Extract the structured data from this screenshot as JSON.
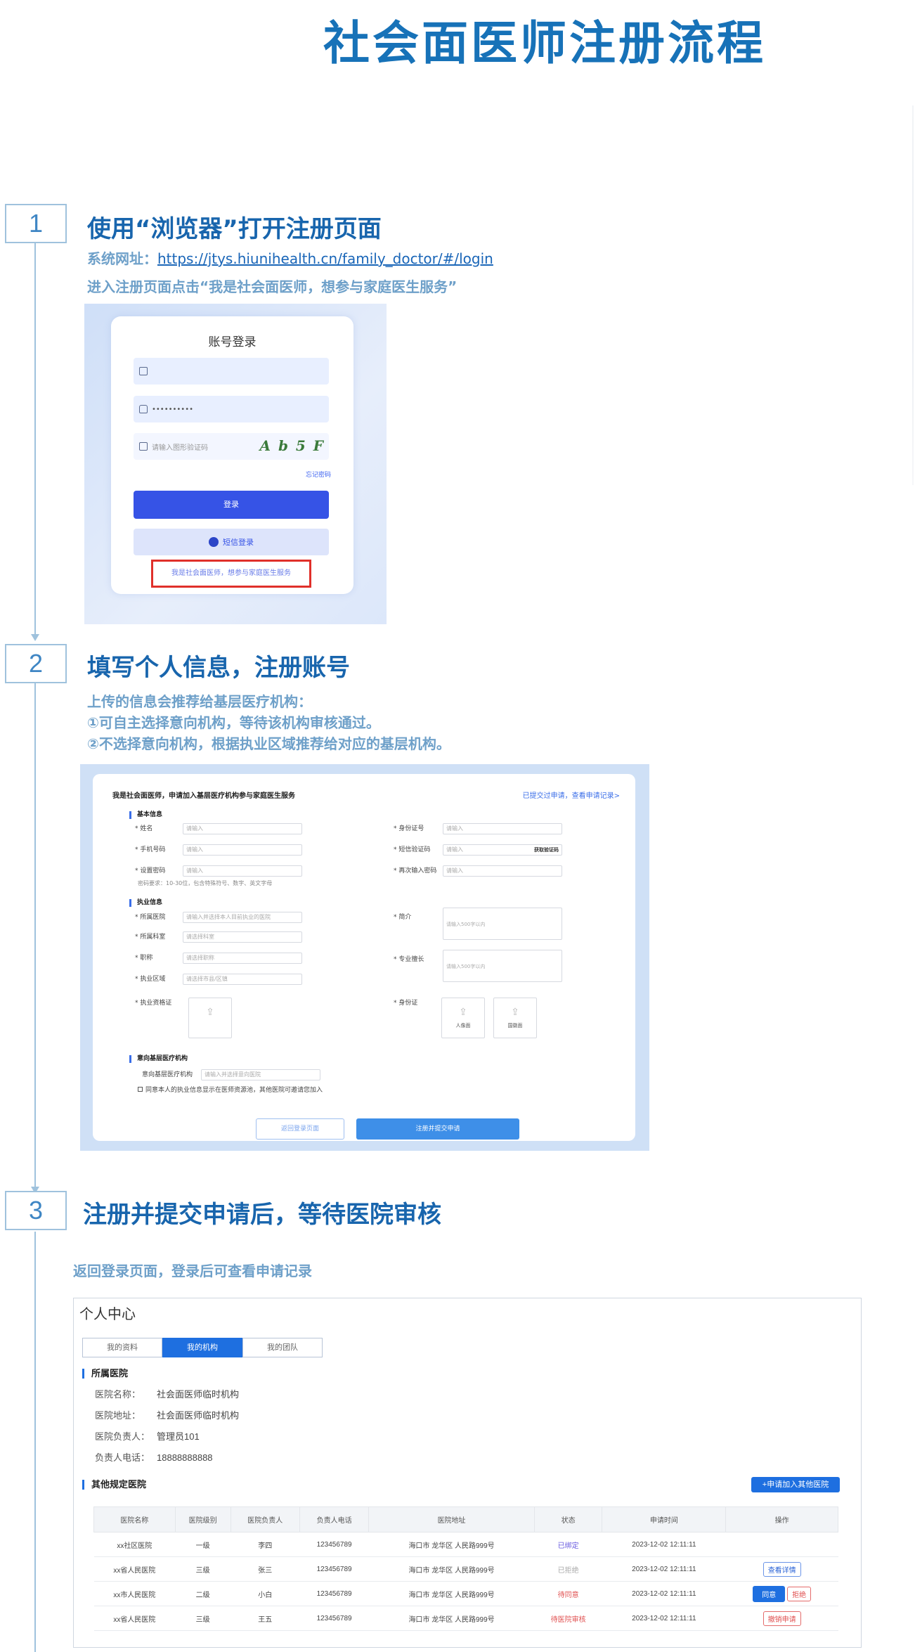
{
  "title": "社会面医师注册流程",
  "steps": [
    {
      "num": "1",
      "title": "使用“浏览器”打开注册页面",
      "url_label": "系统网址：",
      "url": "https://jtys.hiunihealth.cn/family_doctor/#/login",
      "line2": "进入注册页面点击“我是社会面医师，想参与家庭医生服务”"
    },
    {
      "num": "2",
      "title": "填写个人信息，注册账号",
      "line1": "上传的信息会推荐给基层医疗机构：",
      "line2": "①可自主选择意向机构，等待该机构审核通过。",
      "line3": "②不选择意向机构，根据执业区域推荐给对应的基层机构。"
    },
    {
      "num": "3",
      "title": "注册并提交申请后，等待医院审核",
      "line1": "返回登录页面，登录后可查看申请记录"
    }
  ],
  "login": {
    "title": "账号登录",
    "password_mask": "••••••••••",
    "captcha_placeholder": "请输入图形验证码",
    "captcha_text": "A b 5 F",
    "forgot": "忘记密码",
    "login_button": "登录",
    "sms_button": "短信登录",
    "doctor_link": "我是社会面医师，想参与家庭医生服务"
  },
  "form": {
    "header": "我是社会面医师，申请加入基层医疗机构参与家庭医生服务",
    "history_link": "已提交过申请，查看申请记录>",
    "sec_basic": "基本信息",
    "name": "* 姓名",
    "id_no": "* 身份证号",
    "phone": "* 手机号码",
    "sms_code": "* 短信验证码",
    "get_code": "获取验证码",
    "set_pwd": "* 设置密码",
    "re_pwd": "* 再次输入密码",
    "pwd_hint": "密码要求：10-30位，包含特殊符号、数字、英文字母",
    "placeholder": "请输入",
    "sec_practice": "执业信息",
    "hospital": "* 所属医院",
    "hospital_ph": "请输入并选择本人目前执业的医院",
    "dept": "* 所属科室",
    "dept_ph": "请选择科室",
    "title_lbl": "* 职称",
    "title_ph": "请选择职称",
    "area": "* 执业区域",
    "area_ph": "请选择市县/区镇",
    "intro": "* 简介",
    "intro_ph": "请输入500字以内",
    "specialty": "* 专业擅长",
    "specialty_ph": "请输入500字以内",
    "license": "* 执业资格证",
    "idcard": "* 身份证",
    "id_front": "人像面",
    "id_back": "国徽面",
    "sec_intent": "意向基层医疗机构",
    "intent_label": "意向基层医疗机构",
    "intent_ph": "请输入并选择意向医院",
    "agree": "同意本人的执业信息显示在医师资源池，其他医院可邀请您加入",
    "back_button": "返回登录页面",
    "submit_button": "注册并提交申请"
  },
  "center": {
    "title": "个人中心",
    "tabs": [
      "我的资料",
      "我的机构",
      "我的团队"
    ],
    "sec_hospital": "所属医院",
    "info": [
      {
        "k": "医院名称：",
        "v": "社会面医师临时机构"
      },
      {
        "k": "医院地址：",
        "v": "社会面医师临时机构"
      },
      {
        "k": "医院负责人：",
        "v": "管理员101"
      },
      {
        "k": "负责人电话：",
        "v": "18888888888"
      }
    ],
    "sec_other": "其他规定医院",
    "add_button": "+申请加入其他医院",
    "columns": [
      "医院名称",
      "医院级别",
      "医院负责人",
      "负责人电话",
      "医院地址",
      "状态",
      "申请时间",
      "操作"
    ],
    "rows": [
      {
        "name": "xx社区医院",
        "level": "一级",
        "owner": "李四",
        "phone": "123456789",
        "addr": "海口市 龙华区 人民路999号",
        "status": "已绑定",
        "time": "2023-12-02 12:11:11",
        "ops": []
      },
      {
        "name": "xx省人民医院",
        "level": "三级",
        "owner": "张三",
        "phone": "123456789",
        "addr": "海口市 龙华区 人民路999号",
        "status": "已拒绝",
        "time": "2023-12-02 12:11:11",
        "ops": [
          "查看详情"
        ]
      },
      {
        "name": "xx市人民医院",
        "level": "二级",
        "owner": "小白",
        "phone": "123456789",
        "addr": "海口市 龙华区 人民路999号",
        "status": "待同意",
        "time": "2023-12-02 12:11:11",
        "ops": [
          "同意",
          "拒绝"
        ]
      },
      {
        "name": "xx省人民医院",
        "level": "三级",
        "owner": "王五",
        "phone": "123456789",
        "addr": "海口市 龙华区 人民路999号",
        "status": "待医院审核",
        "time": "2023-12-02 12:11:11",
        "ops": [
          "撤销申请"
        ]
      }
    ]
  }
}
